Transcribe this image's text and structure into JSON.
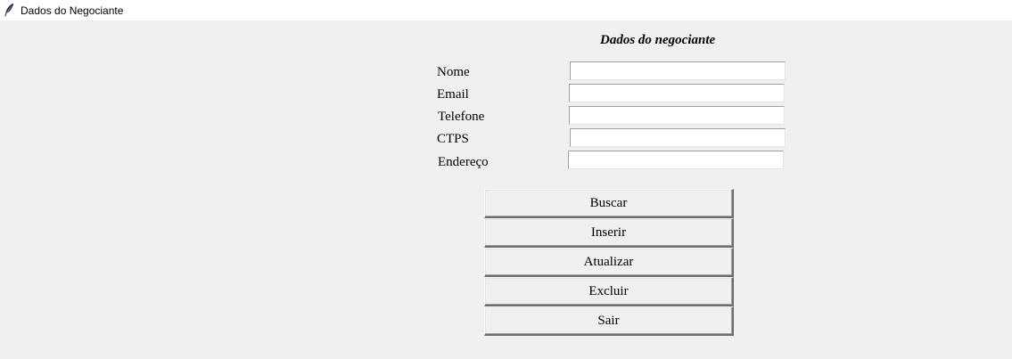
{
  "window": {
    "title": "Dados do Negociante",
    "icon": "feather-icon"
  },
  "form": {
    "heading": "Dados do negociante",
    "fields": [
      {
        "label": "Nome",
        "value": ""
      },
      {
        "label": "Email",
        "value": ""
      },
      {
        "label": "Telefone",
        "value": ""
      },
      {
        "label": "CTPS",
        "value": ""
      },
      {
        "label": "Endereço",
        "value": ""
      }
    ]
  },
  "buttons": {
    "buscar": "Buscar",
    "inserir": "Inserir",
    "atualizar": "Atualizar",
    "excluir": "Excluir",
    "sair": "Sair"
  }
}
